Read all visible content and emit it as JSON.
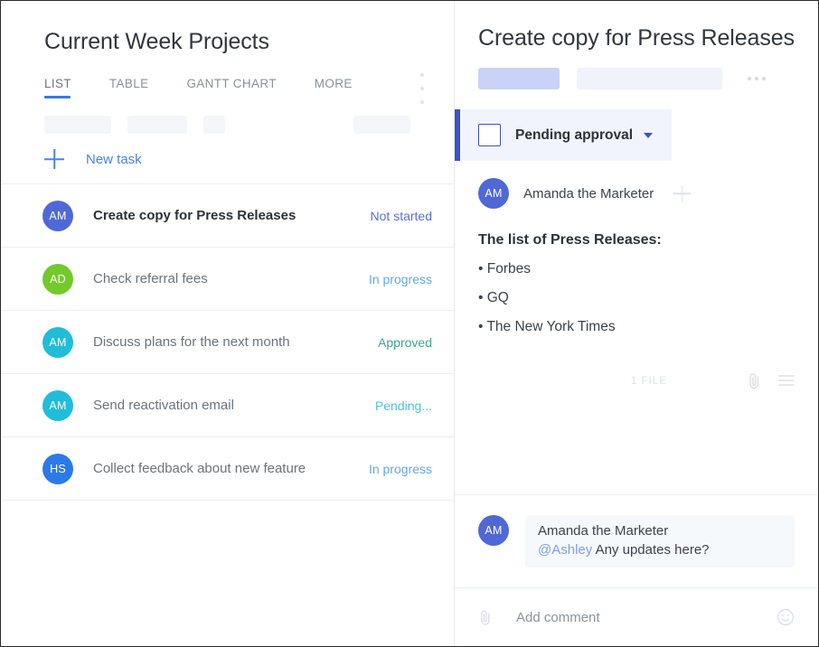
{
  "left_panel": {
    "title": "Current Week Projects",
    "tabs": [
      {
        "label": "LIST",
        "active": true
      },
      {
        "label": "TABLE",
        "active": false
      },
      {
        "label": "GANTT CHART",
        "active": false
      },
      {
        "label": "MORE",
        "active": false
      }
    ],
    "new_task_label": "New task",
    "tasks": [
      {
        "initials": "AM",
        "avatar_color": "#5068d6",
        "title": "Create copy for Press Releases",
        "status": "Not started",
        "status_color": "#5a6fd4",
        "selected": true
      },
      {
        "initials": "AD",
        "avatar_color": "#74c92b",
        "title": "Check referral fees",
        "status": "In progress",
        "status_color": "#62a9e8",
        "selected": false
      },
      {
        "initials": "AM",
        "avatar_color": "#1fbdda",
        "title": "Discuss plans for the next month",
        "status": "Approved",
        "status_color": "#3ba78e",
        "selected": false
      },
      {
        "initials": "AM",
        "avatar_color": "#1fbdda",
        "title": "Send reactivation email",
        "status": "Pending...",
        "status_color": "#4dc2e0",
        "selected": false
      },
      {
        "initials": "HS",
        "avatar_color": "#2c7ae8",
        "title": "Collect feedback about new feature",
        "status": "In progress",
        "status_color": "#62a9e8",
        "selected": false
      }
    ]
  },
  "right_panel": {
    "title": "Create copy for Press Releases",
    "status": {
      "label": "Pending approval",
      "accent_color": "#3f51c4",
      "background_color": "#f2f4fd",
      "checked": false
    },
    "assignee": {
      "initials": "AM",
      "avatar_color": "#5068d6",
      "name": "Amanda the Marketer"
    },
    "description": {
      "heading": "The list of Press Releases:",
      "items": [
        "• Forbes",
        "• GQ",
        "• The New York Times"
      ]
    },
    "file_count_label": "1 FILE",
    "comments": [
      {
        "initials": "AM",
        "avatar_color": "#5068d6",
        "author": "Amanda the Marketer",
        "mention": "@Ashley",
        "text": " Any updates here?"
      }
    ],
    "add_comment_placeholder": "Add comment"
  }
}
